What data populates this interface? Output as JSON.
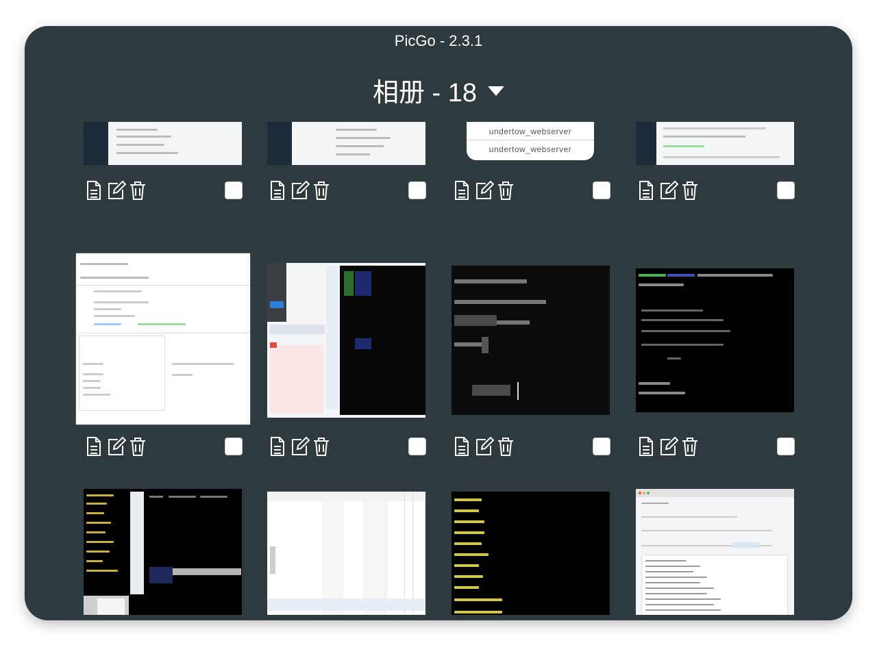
{
  "window": {
    "title": "PicGo - 2.3.1"
  },
  "album": {
    "title": "相册 - 18"
  },
  "thumb_texts": {
    "undertow_1": "undertow_webserver",
    "undertow_2": "undertow_webserver"
  },
  "actions": {
    "copy_icon": "document-icon",
    "edit_icon": "edit-icon",
    "delete_icon": "trash-icon"
  },
  "colors": {
    "window_bg": "#2f3a3e",
    "icon": "#ffffff",
    "checkbox": "#ffffff"
  }
}
